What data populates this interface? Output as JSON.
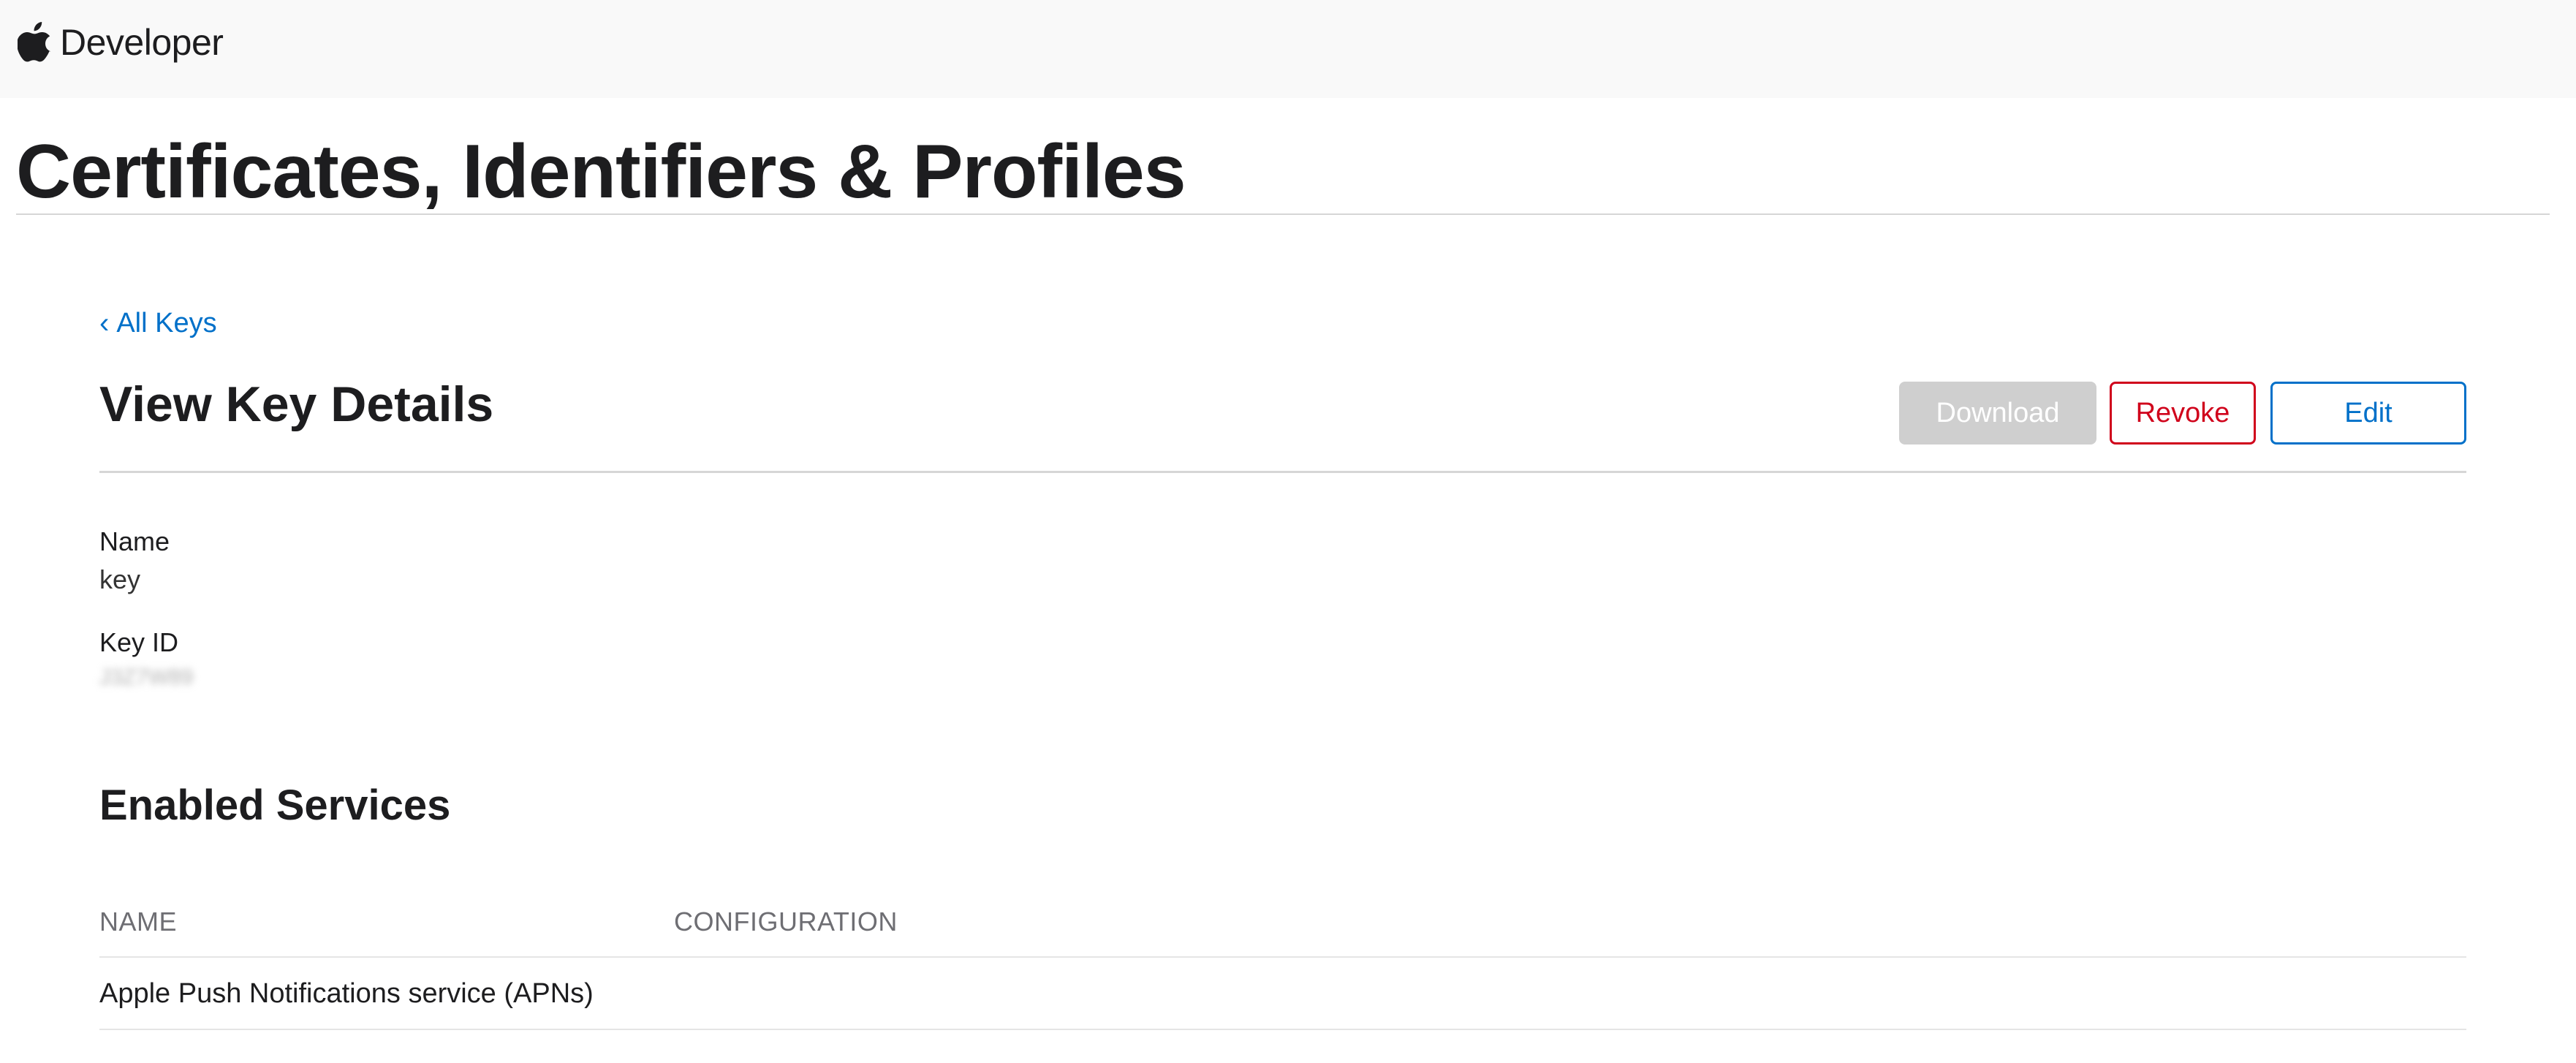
{
  "nav": {
    "brand": "Developer",
    "icon": "apple-logo-icon"
  },
  "page": {
    "title": "Certificates, Identifiers & Profiles"
  },
  "breadcrumb": {
    "back_icon": "chevron-left-icon",
    "back_label": "All Keys"
  },
  "detail": {
    "title": "View Key Details",
    "buttons": {
      "download": "Download",
      "revoke": "Revoke",
      "edit": "Edit"
    },
    "fields": [
      {
        "label": "Name",
        "value": "key"
      },
      {
        "label": "Key ID",
        "value": "J3Z7W89"
      }
    ]
  },
  "services": {
    "title": "Enabled Services",
    "columns": [
      "NAME",
      "CONFIGURATION"
    ],
    "rows": [
      {
        "name": "Apple Push Notifications service (APNs)",
        "configuration": ""
      }
    ]
  },
  "colors": {
    "link": "#0070c9",
    "danger": "#d0021b",
    "disabled": "#cfcfcf",
    "nav_bg": "#f9f9f9"
  }
}
